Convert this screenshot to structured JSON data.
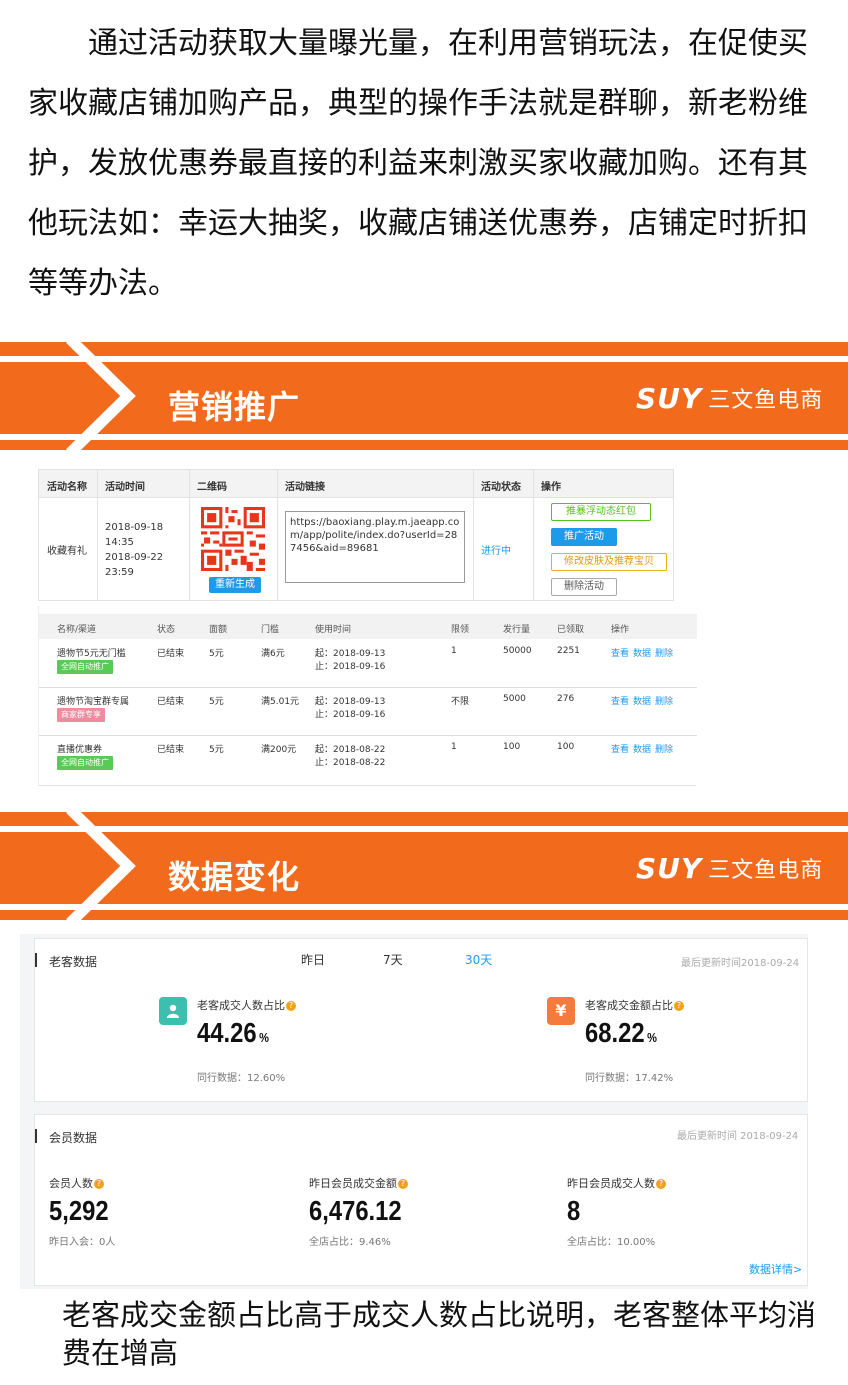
{
  "intro_text": "通过活动获取大量曝光量，在利用营销玩法，在促使买家收藏店铺加购产品，典型的操作手法就是群聊，新老粉维护，发放优惠券最直接的利益来刺激买家收藏加购。还有其他玩法如：幸运大抽奖，收藏店铺送优惠券，店铺定时折扣等等办法。",
  "banner1": {
    "title": "营销推广",
    "logo_en": "SUY",
    "logo_cn": "三文鱼电商"
  },
  "banner2": {
    "title": "数据变化",
    "logo_en": "SUY",
    "logo_cn": "三文鱼电商"
  },
  "activity_table": {
    "headers": [
      "活动名称",
      "活动时间",
      "二维码",
      "活动链接",
      "活动状态",
      "操作"
    ],
    "row": {
      "name": "收藏有礼",
      "time_lines": [
        "2018-09-18",
        "14:35",
        "2018-09-22",
        "23:59"
      ],
      "regen_label": "重新生成",
      "link": "https://baoxiang.play.m.jaeapp.com/app/polite/index.do?userId=287456&aid=89681",
      "status": "进行中",
      "ops": [
        "推暴浮动态红包",
        "推广活动",
        "修改皮肤及推荐宝贝",
        "删除活动"
      ]
    }
  },
  "coupon_table": {
    "headers": [
      "名称/渠道",
      "状态",
      "面额",
      "门槛",
      "使用时间",
      "限领",
      "发行量",
      "已领取",
      "操作"
    ],
    "rows": [
      {
        "name": "遗物节5元无门槛",
        "tag": "全网自动推广",
        "tag_color": "#5cc85c",
        "status": "已结束",
        "amount": "5元",
        "threshold": "满6元",
        "start": "起：2018-09-13",
        "end": "止：2018-09-16",
        "limit": "1",
        "issued": "50000",
        "claimed": "2251"
      },
      {
        "name": "遗物节淘宝群专属",
        "tag": "商家群专享",
        "tag_color": "#f08ca0",
        "status": "已结束",
        "amount": "5元",
        "threshold": "满5.01元",
        "start": "起：2018-09-13",
        "end": "止：2018-09-16",
        "limit": "不限",
        "issued": "5000",
        "claimed": "276"
      },
      {
        "name": "直播优惠券",
        "tag": "全网自动推广",
        "tag_color": "#5cc85c",
        "status": "已结束",
        "amount": "5元",
        "threshold": "满200元",
        "start": "起：2018-08-22",
        "end": "止：2018-08-22",
        "limit": "1",
        "issued": "100",
        "claimed": "100"
      }
    ],
    "actions": [
      "查看",
      "数据",
      "删除"
    ]
  },
  "old_customer": {
    "title": "老客数据",
    "tabs": [
      "昨日",
      "7天",
      "30天"
    ],
    "active_tab": "30天",
    "updated": "最后更新时间2018-09-24",
    "metrics": [
      {
        "label": "老客成交人数占比",
        "value": "44.26",
        "unit": "%",
        "peer": "同行数据：12.60%",
        "icon": "person-icon",
        "icon_color": "#3cbfae",
        "icon_glyph": "👤"
      },
      {
        "label": "老客成交金额占比",
        "value": "68.22",
        "unit": "%",
        "peer": "同行数据：17.42%",
        "icon": "yen-icon",
        "icon_color": "#f57b3c",
        "icon_glyph": "¥"
      }
    ]
  },
  "member": {
    "title": "会员数据",
    "updated": "最后更新时间 2018-09-24",
    "metrics": [
      {
        "label": "会员人数",
        "value": "5,292",
        "sub": "昨日入会：0人"
      },
      {
        "label": "昨日会员成交金额",
        "value": "6,476.12",
        "sub": "全店占比：9.46%"
      },
      {
        "label": "昨日会员成交人数",
        "value": "8",
        "sub": "全店占比：10.00%"
      }
    ],
    "detail_link": "数据详情>"
  },
  "outro_text": "老客成交金额占比高于成交人数占比说明，老客整体平均消费在增高"
}
